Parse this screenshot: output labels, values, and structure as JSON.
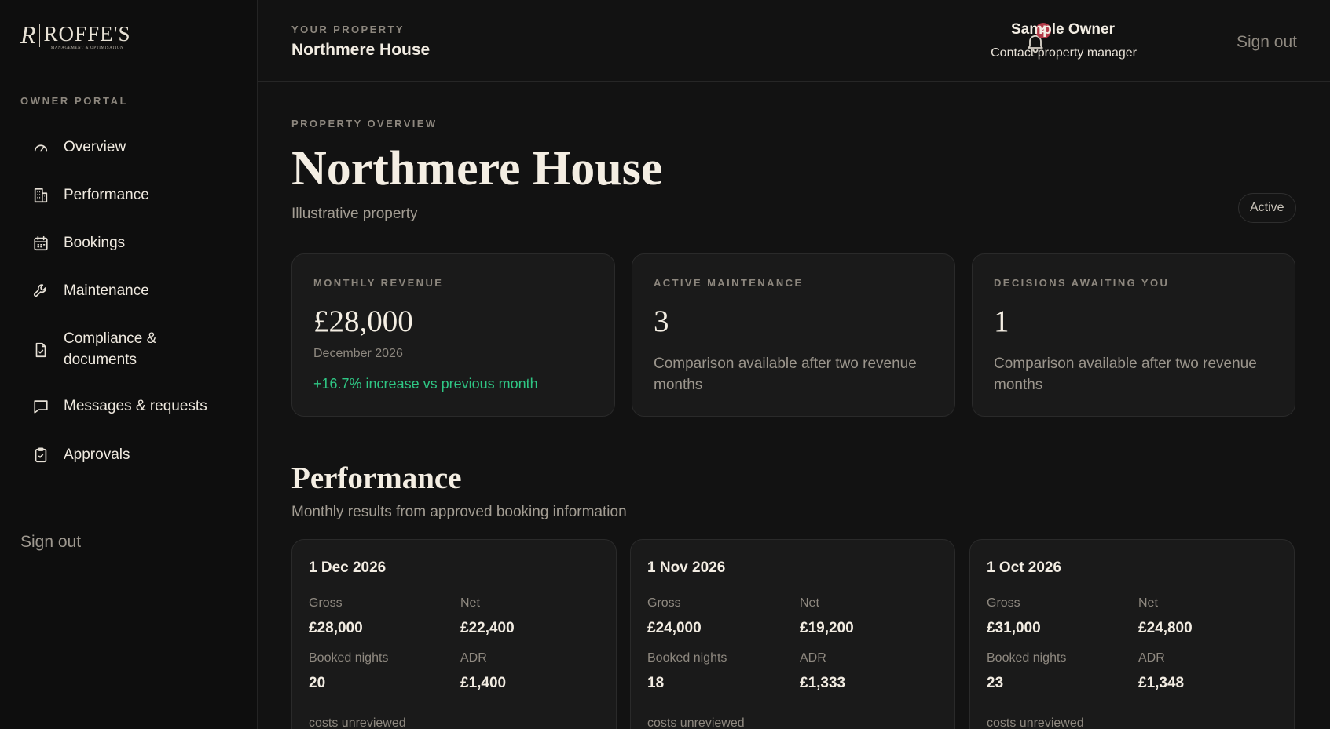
{
  "brand": {
    "mark": "R",
    "name": "ROFFE'S",
    "tagline": "MANAGEMENT & OPTIMISATION"
  },
  "sidebar": {
    "section_label": "OWNER PORTAL",
    "items": [
      {
        "label": "Overview",
        "icon": "gauge-icon"
      },
      {
        "label": "Performance",
        "icon": "building-icon"
      },
      {
        "label": "Bookings",
        "icon": "calendar-icon"
      },
      {
        "label": "Maintenance",
        "icon": "wrench-icon"
      },
      {
        "label": "Compliance & documents",
        "icon": "document-icon"
      },
      {
        "label": "Messages & requests",
        "icon": "message-icon"
      },
      {
        "label": "Approvals",
        "icon": "clipboard-check-icon"
      }
    ],
    "sign_out": "Sign out"
  },
  "header": {
    "eyebrow": "YOUR PROPERTY",
    "title": "Northmere House",
    "notification_count": "4",
    "owner_name": "Sample Owner",
    "contact_link": "Contact property manager",
    "sign_out": "Sign out"
  },
  "overview": {
    "eyebrow": "PROPERTY OVERVIEW",
    "title": "Northmere House",
    "subtitle": "Illustrative property",
    "status": "Active"
  },
  "stats": {
    "revenue": {
      "label": "MONTHLY REVENUE",
      "value": "£28,000",
      "period": "December 2026",
      "change": "+16.7% increase vs previous month"
    },
    "maintenance": {
      "label": "ACTIVE MAINTENANCE",
      "value": "3",
      "note": "Comparison available after two revenue months"
    },
    "decisions": {
      "label": "DECISIONS AWAITING YOU",
      "value": "1",
      "note": "Comparison available after two revenue months"
    }
  },
  "performance": {
    "title": "Performance",
    "subtitle": "Monthly results from approved booking information",
    "labels": {
      "gross": "Gross",
      "net": "Net",
      "nights": "Booked nights",
      "adr": "ADR"
    },
    "months": [
      {
        "date": "1 Dec 2026",
        "gross": "£28,000",
        "net": "£22,400",
        "nights": "20",
        "adr": "£1,400",
        "note": "costs unreviewed"
      },
      {
        "date": "1 Nov 2026",
        "gross": "£24,000",
        "net": "£19,200",
        "nights": "18",
        "adr": "£1,333",
        "note": "costs unreviewed"
      },
      {
        "date": "1 Oct 2026",
        "gross": "£31,000",
        "net": "£24,800",
        "nights": "23",
        "adr": "£1,348",
        "note": "costs unreviewed"
      }
    ]
  },
  "colors": {
    "background": "#121212",
    "sidebar": "#0e0e0e",
    "card": "#1a1a1a",
    "positive": "#2fc684",
    "badge": "#b23a48"
  }
}
